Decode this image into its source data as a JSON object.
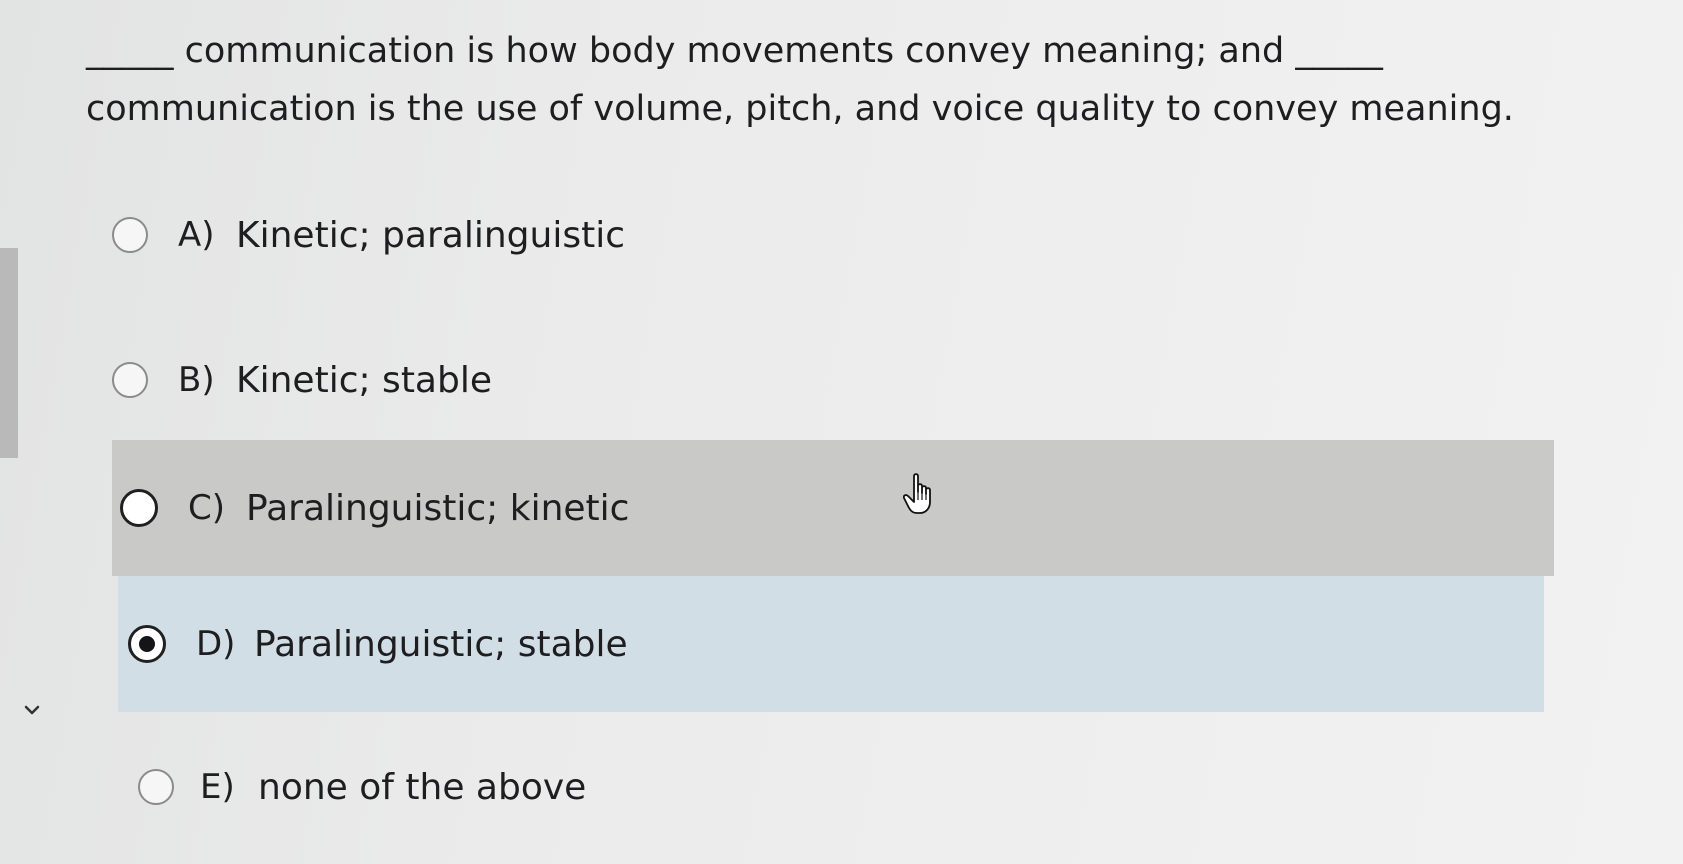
{
  "question": {
    "line1": "_____ communication is how body movements convey meaning; and _____",
    "line2": "communication is the use of volume, pitch, and voice quality to convey meaning."
  },
  "options": [
    {
      "letter": "A)",
      "text": "Kinetic; paralinguistic",
      "selected": false
    },
    {
      "letter": "B)",
      "text": "Kinetic; stable",
      "selected": false
    },
    {
      "letter": "C)",
      "text": "Paralinguistic; kinetic",
      "selected": false,
      "hovered": true
    },
    {
      "letter": "D)",
      "text": "Paralinguistic; stable",
      "selected": true
    },
    {
      "letter": "E)",
      "text": "none of the above",
      "selected": false
    }
  ],
  "icons": {
    "cursor": "hand-pointer-icon",
    "left_nav": "chevron-down-icon"
  },
  "colors": {
    "hover_row": "#c9c9c8",
    "selected_row": "#d2dee5"
  }
}
